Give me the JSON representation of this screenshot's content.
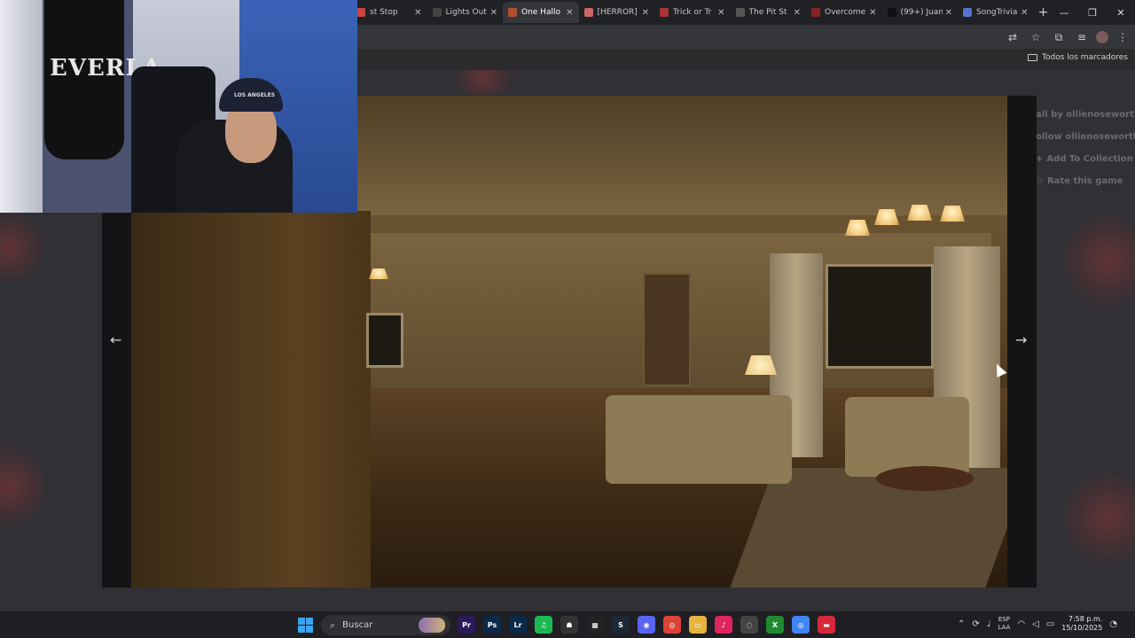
{
  "browser": {
    "tabs": [
      {
        "label": "st Stop",
        "color": "#c44"
      },
      {
        "label": "Lights Out",
        "color": "#444"
      },
      {
        "label": "One Hallo",
        "color": "#b05030",
        "active": true
      },
      {
        "label": "[HERROR]",
        "color": "#c66"
      },
      {
        "label": "Trick or Tr",
        "color": "#a33"
      },
      {
        "label": "The Pit St",
        "color": "#555"
      },
      {
        "label": "Overcome",
        "color": "#822"
      },
      {
        "label": "(99+) Juan",
        "color": "#111"
      },
      {
        "label": "SongTrivia",
        "color": "#5a6fd0"
      }
    ],
    "new_tab": "+",
    "bookmarks_all": "Todos los marcadores"
  },
  "sidepanel": {
    "made_by": "all by ollienoseworthy",
    "follow": "ollow ollienoseworthy",
    "add_collection": "Add To Collection",
    "rate": "Rate this game"
  },
  "viewer": {
    "prev": "←",
    "next": "→"
  },
  "webcam": {
    "bag_text": "EVERLA",
    "cap_text": "LOS ANGELES"
  },
  "taskbar": {
    "search_label": "Buscar",
    "apps": [
      {
        "name": "premiere",
        "label": "Pr",
        "color": "#2a1a5a"
      },
      {
        "name": "photoshop",
        "label": "Ps",
        "color": "#0b2a4a"
      },
      {
        "name": "lightroom",
        "label": "Lr",
        "color": "#0b2a4a"
      },
      {
        "name": "spotify",
        "label": "♫",
        "color": "#1db954"
      },
      {
        "name": "app-ghost",
        "label": "☗",
        "color": "#333"
      },
      {
        "name": "capcut",
        "label": "▦",
        "color": "#222"
      },
      {
        "name": "steam",
        "label": "S",
        "color": "#1b2838"
      },
      {
        "name": "discord",
        "label": "◉",
        "color": "#5865f2"
      },
      {
        "name": "chrome",
        "label": "◎",
        "color": "#db4437"
      },
      {
        "name": "file-explorer",
        "label": "▭",
        "color": "#e6b340"
      },
      {
        "name": "tiktok",
        "label": "♪",
        "color": "#e0245e"
      },
      {
        "name": "app-circle",
        "label": "◌",
        "color": "#444"
      },
      {
        "name": "xbox",
        "label": "X",
        "color": "#1f8a2e"
      },
      {
        "name": "chrome-2",
        "label": "◎",
        "color": "#4285f4"
      },
      {
        "name": "app-red",
        "label": "▬",
        "color": "#d8263a"
      }
    ],
    "lang_top": "ESP",
    "lang_bottom": "LAA",
    "time": "7:58 p.m.",
    "date": "15/10/2025"
  }
}
